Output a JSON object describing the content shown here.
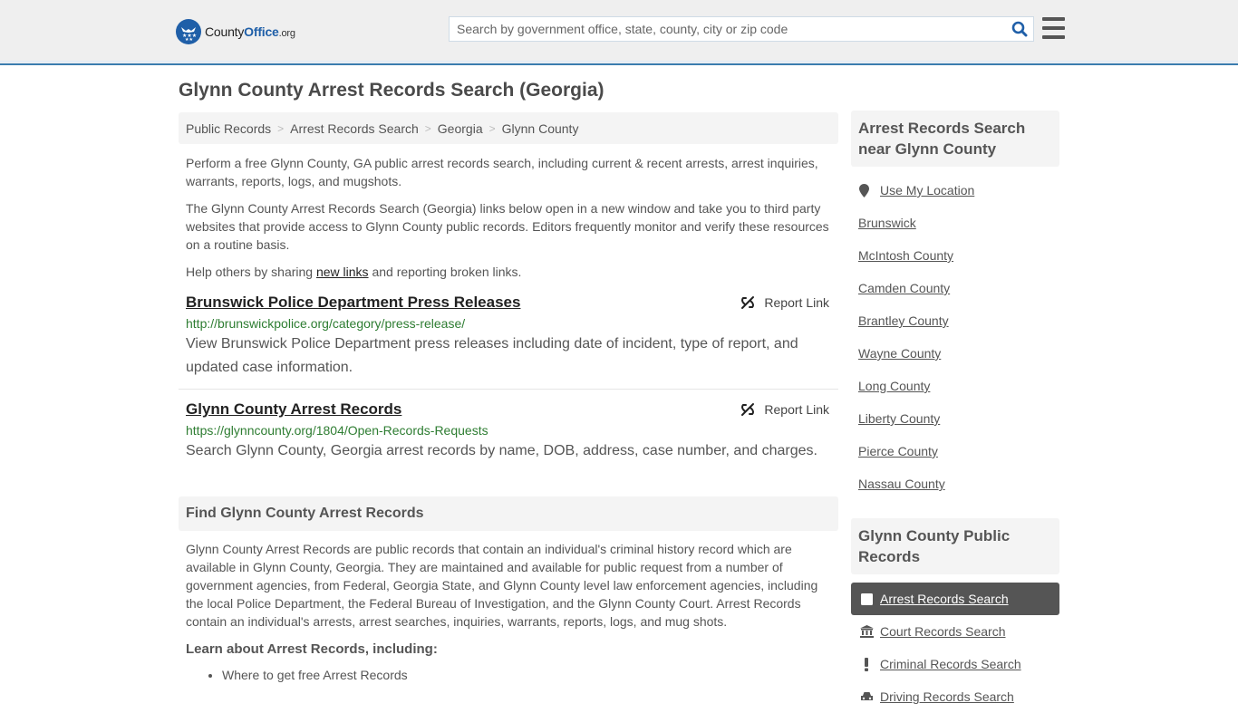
{
  "header": {
    "logo": {
      "name_part1": "County",
      "name_part2": "Office",
      "name_part3": ".org"
    },
    "search": {
      "placeholder": "Search by government office, state, county, city or zip code",
      "value": ""
    },
    "icons": {
      "search": "search-icon",
      "menu": "hamburger-menu-icon"
    }
  },
  "page": {
    "title": "Glynn County Arrest Records Search (Georgia)"
  },
  "breadcrumb": [
    "Public Records",
    "Arrest Records Search",
    "Georgia",
    "Glynn County"
  ],
  "intro": {
    "p1": "Perform a free Glynn County, GA public arrest records search, including current & recent arrests, arrest inquiries, warrants, reports, logs, and mugshots.",
    "p2": "The Glynn County Arrest Records Search (Georgia) links below open in a new window and take you to third party websites that provide access to Glynn County public records. Editors frequently monitor and verify these resources on a routine basis.",
    "p3_before": "Help others by sharing ",
    "p3_link": "new links",
    "p3_after": " and reporting broken links."
  },
  "results": [
    {
      "title": "Brunswick Police Department Press Releases",
      "url": "http://brunswickpolice.org/category/press-release/",
      "description": "View Brunswick Police Department press releases including date of incident, type of report, and updated case information.",
      "report_label": "Report Link"
    },
    {
      "title": "Glynn County Arrest Records",
      "url": "https://glynncounty.org/1804/Open-Records-Requests",
      "description": "Search Glynn County, Georgia arrest records by name, DOB, address, case number, and charges.",
      "report_label": "Report Link"
    }
  ],
  "find_section": {
    "heading": "Find Glynn County Arrest Records",
    "body": "Glynn County Arrest Records are public records that contain an individual's criminal history record which are available in Glynn County, Georgia. They are maintained and available for public request from a number of government agencies, from Federal, Georgia State, and Glynn County level law enforcement agencies, including the local Police Department, the Federal Bureau of Investigation, and the Glynn County Court. Arrest Records contain an individual's arrests, arrest searches, inquiries, warrants, reports, logs, and mug shots.",
    "learn_heading": "Learn about Arrest Records, including:",
    "learn_items": [
      "Where to get free Arrest Records"
    ]
  },
  "sidebar": {
    "nearby_heading": "Arrest Records Search near Glynn County",
    "use_location": "Use My Location",
    "nearby": [
      "Brunswick",
      "McIntosh County",
      "Camden County",
      "Brantley County",
      "Wayne County",
      "Long County",
      "Liberty County",
      "Pierce County",
      "Nassau County"
    ],
    "public_records_heading": "Glynn County Public Records",
    "public_records": [
      {
        "label": "Arrest Records Search",
        "icon": "square-icon",
        "active": true
      },
      {
        "label": "Court Records Search",
        "icon": "courthouse-icon",
        "active": false
      },
      {
        "label": "Criminal Records Search",
        "icon": "exclamation-icon",
        "active": false
      },
      {
        "label": "Driving Records Search",
        "icon": "car-icon",
        "active": false
      }
    ]
  },
  "colors": {
    "brand_blue": "#1f5fa8",
    "header_border": "#3a7caf",
    "url_green": "#2e7d32",
    "active_bg": "#555555"
  }
}
